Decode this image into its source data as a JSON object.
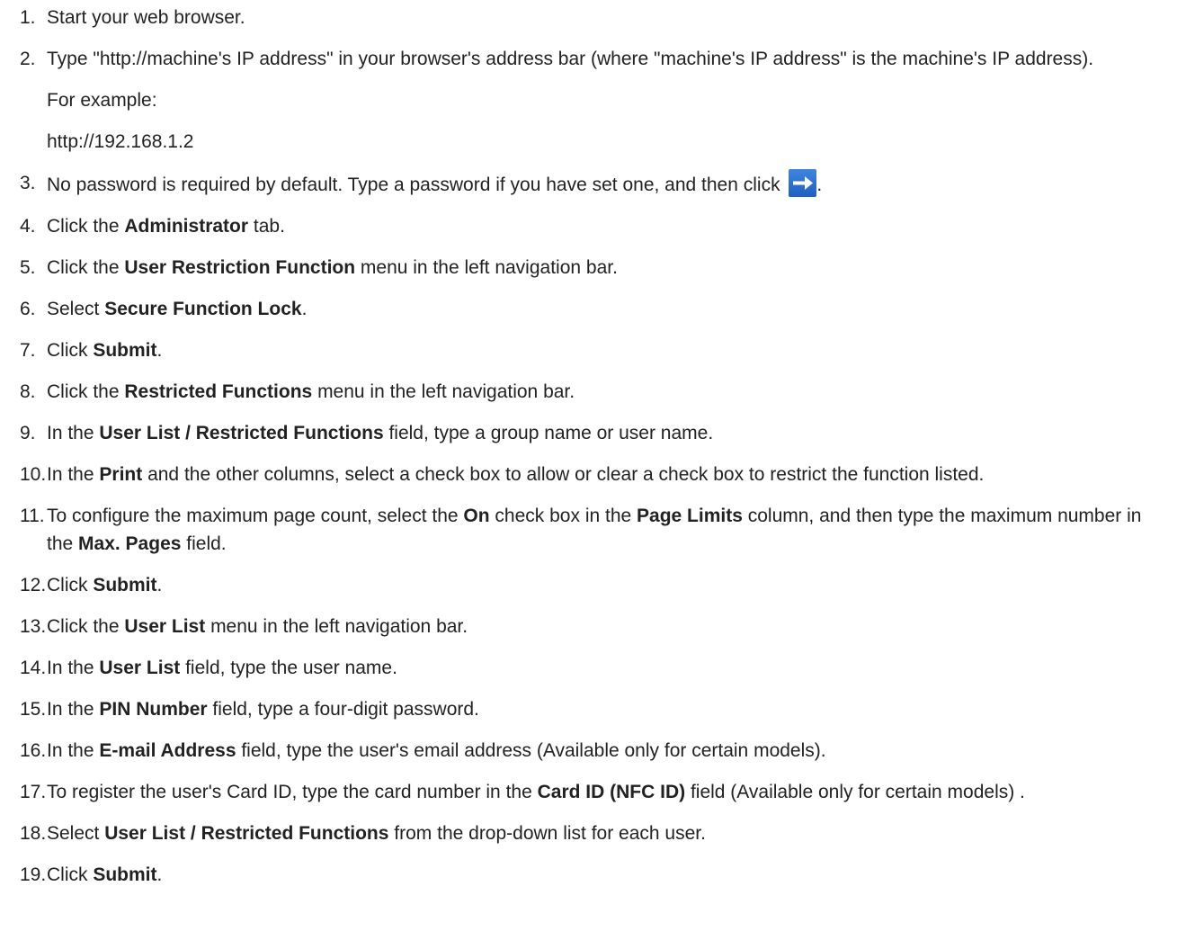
{
  "steps": [
    {
      "n": "1.",
      "parts": [
        {
          "t": "Start your web browser."
        }
      ]
    },
    {
      "n": "2.",
      "parts": [
        {
          "t": "Type \"http://machine's IP address\" in your browser's address bar (where \"machine's IP address\" is the machine's IP address)."
        }
      ],
      "extra": [
        "For example:",
        "http://192.168.1.2"
      ]
    },
    {
      "n": "3.",
      "parts": [
        {
          "t": "No password is required by default. Type a password if you have set one, and then click "
        },
        {
          "icon": "arrow-right-icon"
        },
        {
          "t": "."
        }
      ]
    },
    {
      "n": "4.",
      "parts": [
        {
          "t": "Click the "
        },
        {
          "b": "Administrator"
        },
        {
          "t": " tab."
        }
      ]
    },
    {
      "n": "5.",
      "parts": [
        {
          "t": "Click the "
        },
        {
          "b": "User Restriction Function"
        },
        {
          "t": " menu in the left navigation bar."
        }
      ]
    },
    {
      "n": "6.",
      "parts": [
        {
          "t": "Select "
        },
        {
          "b": "Secure Function Lock"
        },
        {
          "t": "."
        }
      ]
    },
    {
      "n": "7.",
      "parts": [
        {
          "t": "Click "
        },
        {
          "b": "Submit"
        },
        {
          "t": "."
        }
      ]
    },
    {
      "n": "8.",
      "parts": [
        {
          "t": "Click the "
        },
        {
          "b": "Restricted Functions"
        },
        {
          "t": " menu in the left navigation bar."
        }
      ]
    },
    {
      "n": "9.",
      "parts": [
        {
          "t": "In the "
        },
        {
          "b": "User List / Restricted Functions"
        },
        {
          "t": " field, type a group name or user name."
        }
      ]
    },
    {
      "n": "10.",
      "parts": [
        {
          "t": "In the "
        },
        {
          "b": "Print"
        },
        {
          "t": " and the other columns, select a check box to allow or clear a check box to restrict the function listed."
        }
      ]
    },
    {
      "n": "11.",
      "parts": [
        {
          "t": "To configure the maximum page count, select the "
        },
        {
          "b": "On"
        },
        {
          "t": " check box in the "
        },
        {
          "b": "Page Limits"
        },
        {
          "t": " column, and then type the maximum number in the "
        },
        {
          "b": "Max. Pages"
        },
        {
          "t": " field."
        }
      ]
    },
    {
      "n": "12.",
      "parts": [
        {
          "t": "Click "
        },
        {
          "b": "Submit"
        },
        {
          "t": "."
        }
      ]
    },
    {
      "n": "13.",
      "parts": [
        {
          "t": "Click the "
        },
        {
          "b": "User List"
        },
        {
          "t": " menu in the left navigation bar."
        }
      ]
    },
    {
      "n": "14.",
      "parts": [
        {
          "t": "In the "
        },
        {
          "b": "User List"
        },
        {
          "t": " field, type the user name."
        }
      ]
    },
    {
      "n": "15.",
      "parts": [
        {
          "t": "In the "
        },
        {
          "b": "PIN Number"
        },
        {
          "t": " field, type a four-digit password."
        }
      ]
    },
    {
      "n": "16.",
      "parts": [
        {
          "t": "In the "
        },
        {
          "b": "E-mail Address"
        },
        {
          "t": " field, type the user's email address (Available only for certain models)."
        }
      ]
    },
    {
      "n": "17.",
      "parts": [
        {
          "t": "To register the user's Card ID, type the card number in the "
        },
        {
          "b": "Card ID (NFC ID)"
        },
        {
          "t": " field (Available only for certain models) ."
        }
      ]
    },
    {
      "n": "18.",
      "parts": [
        {
          "t": "Select "
        },
        {
          "b": "User List / Restricted Functions"
        },
        {
          "t": " from the drop-down list for each user."
        }
      ]
    },
    {
      "n": "19.",
      "parts": [
        {
          "t": "Click "
        },
        {
          "b": "Submit"
        },
        {
          "t": "."
        }
      ]
    }
  ],
  "colors": {
    "text": "#222222",
    "icon_bg": "#1f5fbf",
    "icon_arrow": "#ffffff"
  }
}
